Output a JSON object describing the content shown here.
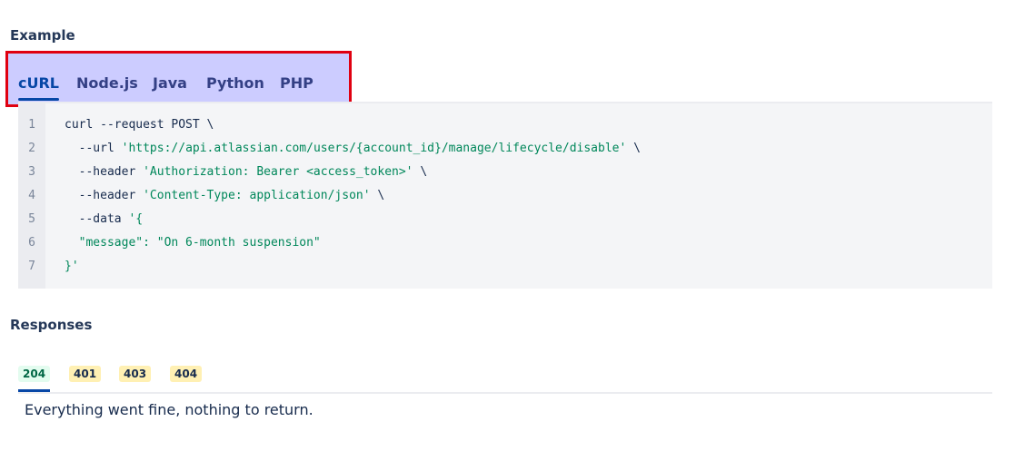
{
  "example": {
    "title": "Example",
    "tabs": [
      "cURL",
      "Node.js",
      "Java",
      "Python",
      "PHP"
    ],
    "active_tab": "cURL",
    "code_lines": [
      {
        "n": "1",
        "plain": "curl --request POST \\",
        "str": "",
        "tail": ""
      },
      {
        "n": "2",
        "plain": "  --url ",
        "str": "'https://api.atlassian.com/users/{account_id}/manage/lifecycle/disable'",
        "tail": " \\"
      },
      {
        "n": "3",
        "plain": "  --header ",
        "str": "'Authorization: Bearer <access_token>'",
        "tail": " \\"
      },
      {
        "n": "4",
        "plain": "  --header ",
        "str": "'Content-Type: application/json'",
        "tail": " \\"
      },
      {
        "n": "5",
        "plain": "  --data ",
        "str": "'{",
        "tail": ""
      },
      {
        "n": "6",
        "plain": "",
        "str": "  \"message\": \"On 6-month suspension\"",
        "tail": ""
      },
      {
        "n": "7",
        "plain": "",
        "str": "}'",
        "tail": ""
      }
    ]
  },
  "responses": {
    "title": "Responses",
    "codes": [
      "204",
      "401",
      "403",
      "404"
    ],
    "active": "204",
    "description": "Everything went fine, nothing to return."
  }
}
